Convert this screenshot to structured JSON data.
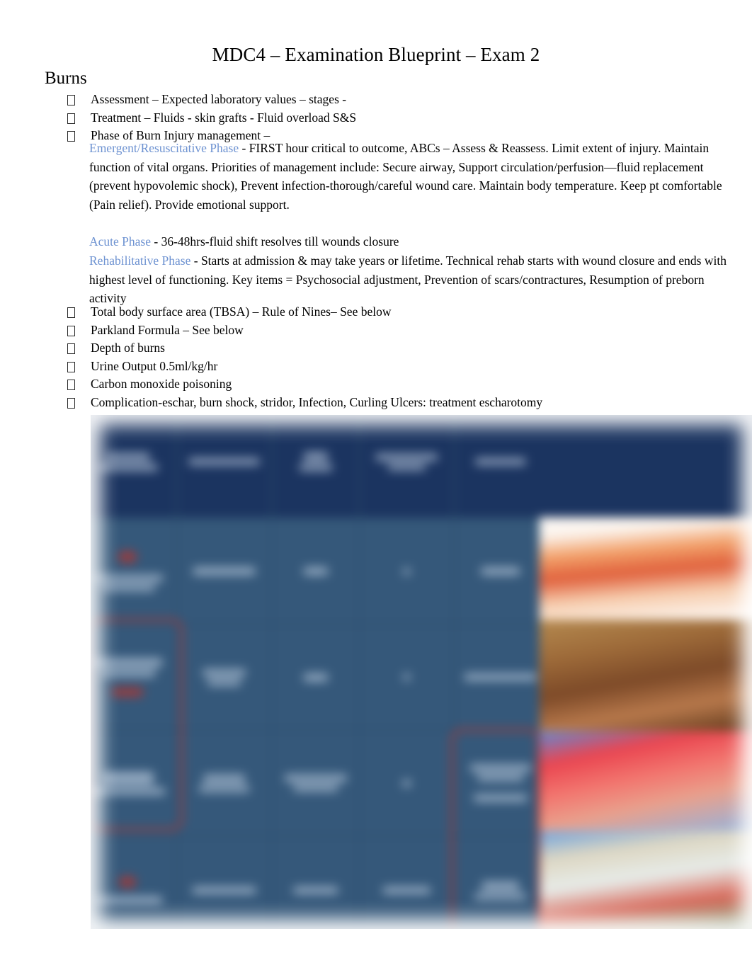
{
  "document": {
    "title": "MDC4 – Examination Blueprint – Exam 2",
    "section_heading": "Burns"
  },
  "bullets_top": [
    {
      "text": "Assessment  – Expected laboratory values – stages -"
    },
    {
      "text": "Treatment  – Fluids - skin grafts - Fluid overload S&S"
    },
    {
      "text": "Phase of Burn Injury management  –"
    }
  ],
  "phases": {
    "emergent": {
      "label": "Emergent/Resuscitative Phase",
      "body": "  - FIRST hour critical to outcome, ABCs – Assess & Reassess. Limit extent of injury. Maintain function of vital organs. Priorities of management include:   Secure airway,  Support circulation/perfusion—fluid replacement (prevent hypovolemic shock), Prevent infection-thorough/careful wound care. Maintain body temperature. Keep pt comfortable (Pain relief). Provide emotional support."
    },
    "acute": {
      "label": "Acute Phase",
      "body": " - 36-48hrs-fluid shift resolves till wounds closure"
    },
    "rehabilitative": {
      "label": "Rehabilitative Phase",
      "body": "  - Starts at admission & may take years or lifetime. Technical rehab starts with wound closure and ends with highest level of functioning. Key items = Psychosocial adjustment, Prevention of scars/contractures, Resumption of preborn activity"
    }
  },
  "bullets_lower": [
    {
      "text": "Total body surface area (TBSA) – Rule of Nines– See below"
    },
    {
      "text": "Parkland Formula – See below"
    },
    {
      "text": "Depth of burns"
    },
    {
      "text": "Urine Output 0.5ml/kg/hr"
    },
    {
      "text": "Carbon monoxide poisoning"
    },
    {
      "text": "Complication-eschar, burn shock, stridor, Infection, Curling Ulcers: treatment escharotomy"
    }
  ],
  "embedded_image": {
    "description": "Blurred screenshot of a burn classification table",
    "header_color": "#1b3460",
    "cell_color": "#35587a",
    "annotation_color": "#b03730",
    "columns": 5,
    "body_rows": 4,
    "text_legible": false
  },
  "colors": {
    "phase_label": "#6d92d1",
    "body_text": "#000000",
    "page_background": "#ffffff"
  }
}
